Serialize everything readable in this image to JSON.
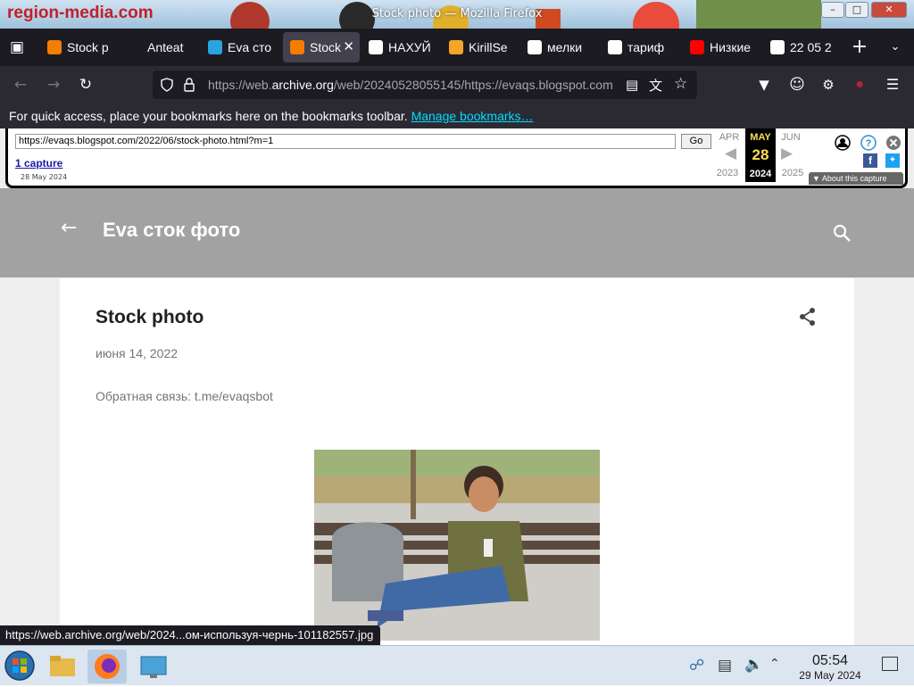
{
  "window": {
    "title": "Stock photo — Mozilla Firefox",
    "bg_logo_text": "region-media.com",
    "controls": [
      "minimize",
      "maximize",
      "close"
    ]
  },
  "tabs": [
    {
      "label": "Stock p",
      "favicon": "blogger-icon",
      "color": "#f57d00",
      "active": false
    },
    {
      "label": "Anteat",
      "favicon": "anteater-icon",
      "color": "#1c1b22",
      "active": false
    },
    {
      "label": "Eva сто",
      "favicon": "telegram-icon",
      "color": "#2aa3e0",
      "active": false
    },
    {
      "label": "Stock",
      "favicon": "blogger-icon",
      "color": "#f57d00",
      "active": true
    },
    {
      "label": "НАХУЙ",
      "favicon": "square-icon",
      "color": "#ffffff",
      "active": false
    },
    {
      "label": "KirillSe",
      "favicon": "lemon-icon",
      "color": "#f5a623",
      "active": false
    },
    {
      "label": "мелки",
      "favicon": "google-icon",
      "color": "#ffffff",
      "active": false
    },
    {
      "label": "тариф",
      "favicon": "google-icon",
      "color": "#ffffff",
      "active": false
    },
    {
      "label": "Низкие",
      "favicon": "youtube-icon",
      "color": "#ff0000",
      "active": false
    },
    {
      "label": "22 05 2",
      "favicon": "google-icon",
      "color": "#ffffff",
      "active": false
    }
  ],
  "nav": {
    "url_prefix": "https://web.",
    "url_domain": "archive.org",
    "url_rest": "/web/20240528055145/https://evaqs.blogspot.com"
  },
  "bookmarks_bar": {
    "text": "For quick access, place your bookmarks here on the bookmarks toolbar.",
    "link": "Manage bookmarks…"
  },
  "wayback": {
    "url_value": "https://evaqs.blogspot.com/2022/06/stock-photo.html?m=1",
    "go_label": "Go",
    "captures_label": "1 capture",
    "capture_date": "28 May 2024",
    "prev_month": "APR",
    "cur_month": "MAY",
    "next_month": "JUN",
    "cur_day": "28",
    "prev_year": "2023",
    "cur_year": "2024",
    "next_year": "2025",
    "about_label": "About this capture"
  },
  "blog": {
    "title": "Eva сток фото",
    "post_title": "Stock photo",
    "post_date": "июня 14, 2022",
    "post_body": "Обратная связь: t.me/evaqsbot"
  },
  "status_url": "https://web.archive.org/web/2024...ом-используя-чернь-101182557.jpg",
  "taskbar": {
    "time": "05:54",
    "date": "29 May 2024"
  }
}
